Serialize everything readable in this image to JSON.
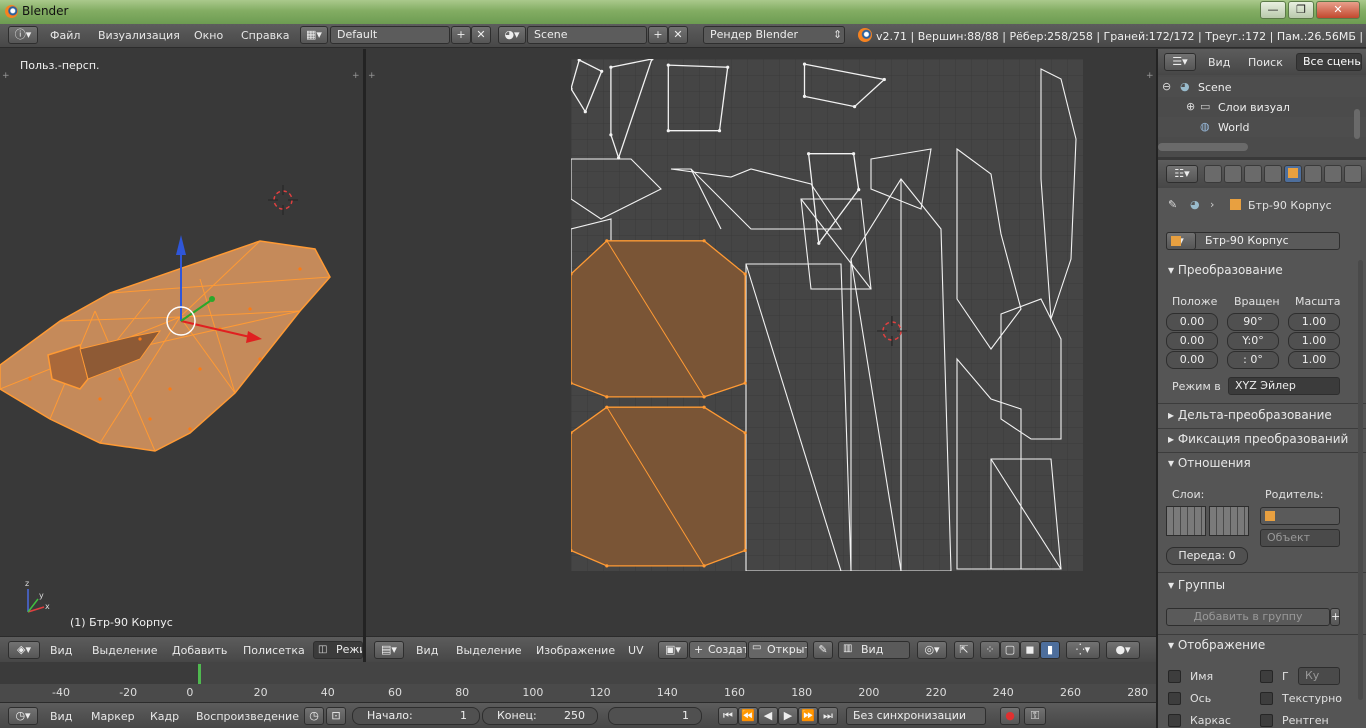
{
  "window": {
    "title": "Blender",
    "buttons": [
      "—",
      "❐",
      "✕"
    ]
  },
  "info_header": {
    "menu": [
      "Файл",
      "Визуализация",
      "Окно",
      "Справка"
    ],
    "layout": "Default",
    "scene": "Scene",
    "engine": "Рендер Blender",
    "stats": "v2.71 | Вершин:88/88 | Рёбер:258/258 | Граней:172/172 | Треуг.:172 | Пам.:26.56МБ | Бтр-"
  },
  "view3d": {
    "label": "Польз.-персп.",
    "object_label": "(1) Бтр-90 Корпус",
    "header_menu": [
      "Вид",
      "Выделение",
      "Добавить",
      "Полисетка",
      "Режи"
    ],
    "axis": {
      "x": "x",
      "y": "y",
      "z": "z"
    }
  },
  "uv_editor": {
    "header_menu": [
      "Вид",
      "Выделение",
      "Изображение",
      "UV"
    ],
    "new_btn": "Создат",
    "open_btn": "Открыт",
    "view_select": "Вид",
    "islands": [
      [
        [
          0.016,
          0.002
        ],
        [
          0.06,
          0.024
        ],
        [
          0.028,
          0.103
        ],
        [
          0.0,
          0.058
        ]
      ],
      [
        [
          0.078,
          0.016
        ],
        [
          0.158,
          0.0
        ],
        [
          0.093,
          0.193
        ],
        [
          0.078,
          0.148
        ]
      ],
      [
        [
          0.19,
          0.012
        ],
        [
          0.306,
          0.016
        ],
        [
          0.29,
          0.14
        ],
        [
          0.19,
          0.14
        ]
      ],
      [
        [
          0.456,
          0.01
        ],
        [
          0.612,
          0.04
        ],
        [
          0.554,
          0.093
        ],
        [
          0.456,
          0.073
        ]
      ],
      [
        [
          0.464,
          0.185
        ],
        [
          0.552,
          0.185
        ],
        [
          0.562,
          0.255
        ],
        [
          0.484,
          0.36
        ]
      ]
    ],
    "selected_islands": [
      [
        [
          0.07,
          0.355
        ],
        [
          0.26,
          0.355
        ],
        [
          0.34,
          0.42
        ],
        [
          0.34,
          0.633
        ],
        [
          0.26,
          0.66
        ],
        [
          0.07,
          0.66
        ],
        [
          0.0,
          0.633
        ],
        [
          0.0,
          0.42
        ]
      ],
      [
        [
          0.07,
          0.68
        ],
        [
          0.26,
          0.68
        ],
        [
          0.34,
          0.73
        ],
        [
          0.34,
          0.96
        ],
        [
          0.26,
          0.99
        ],
        [
          0.07,
          0.99
        ],
        [
          0.0,
          0.96
        ],
        [
          0.0,
          0.73
        ]
      ]
    ]
  },
  "timeline": {
    "ticks": [
      "-40",
      "-20",
      "0",
      "20",
      "40",
      "60",
      "80",
      "100",
      "120",
      "140",
      "160",
      "180",
      "200",
      "220",
      "240",
      "260",
      "280"
    ],
    "current_frame": "1",
    "header_menu": [
      "Вид",
      "Маркер",
      "Кадр",
      "Воспроизведение"
    ],
    "start_label": "Начало:",
    "start_value": "1",
    "end_label": "Конец:",
    "end_value": "250",
    "frame_value": "1",
    "sync": "Без синхронизации"
  },
  "outliner": {
    "menu": [
      "Вид",
      "Поиск"
    ],
    "all_scenes": "Все сцены",
    "items": [
      "Scene",
      "Слои визуали",
      "World"
    ]
  },
  "properties": {
    "object_path": "Бтр-90 Корпус",
    "object_name": "Бтр-90 Корпус",
    "transform": {
      "title": "Преобразование",
      "loc_label": "Положе",
      "rot_label": "Вращен",
      "scale_label": "Масшта",
      "loc": [
        "0.00",
        "0.00",
        "0.00"
      ],
      "rot": [
        "90°",
        "Y:0°",
        ": 0°"
      ],
      "scale": [
        "1.00",
        "1.00",
        "1.00"
      ],
      "mode_label": "Режим в",
      "mode_value": "XYZ Эйлер"
    },
    "delta": "Дельта-преобразование",
    "lock": "Фиксация преобразований",
    "relations": {
      "title": "Отношения",
      "layers": "Слои:",
      "parent": "Родитель:",
      "object_ph": "Объект",
      "pass": "Переда: 0"
    },
    "groups": {
      "title": "Группы",
      "add": "Добавить в группу"
    },
    "display": {
      "title": "Отображение",
      "name": "Имя",
      "g": "Г",
      "ku": "Ку",
      "axes": "Ось",
      "texture": "Текстурно",
      "wire": "Каркас",
      "xray": "Рентген"
    }
  },
  "colors": {
    "accent": "#ff9a34",
    "uv_selected": "#7a5536",
    "active_tab": "#4d6e9c"
  }
}
